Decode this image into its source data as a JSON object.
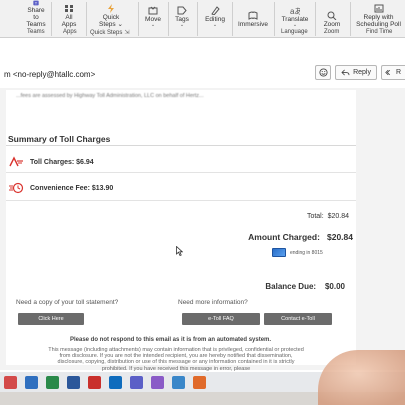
{
  "ribbon": {
    "buttons": [
      {
        "label_line1": "Share to",
        "label_line2": "Teams",
        "icon": "teams-icon"
      },
      {
        "label_line1": "All",
        "label_line2": "Apps",
        "icon": "apps-icon"
      },
      {
        "label_line1": "Quick",
        "label_line2": "Steps",
        "icon": "quick-steps-icon"
      },
      {
        "label_line1": "Move",
        "label_line2": "",
        "icon": "move-icon"
      },
      {
        "label_line1": "Tags",
        "label_line2": "",
        "icon": "tags-icon"
      },
      {
        "label_line1": "Editing",
        "label_line2": "",
        "icon": "editing-icon"
      },
      {
        "label_line1": "Immersive",
        "label_line2": "",
        "icon": "immersive-reader-icon"
      },
      {
        "label_line1": "Translate",
        "label_line2": "",
        "icon": "translate-icon"
      },
      {
        "label_line1": "Zoom",
        "label_line2": "",
        "icon": "zoom-icon"
      },
      {
        "label_line1": "Reply with",
        "label_line2": "Scheduling Poll",
        "icon": "scheduling-poll-icon"
      }
    ],
    "groups": {
      "teams": "Teams",
      "apps": "Apps",
      "quick_steps": "Quick Steps",
      "language": "Language",
      "zoom": "Zoom",
      "find_time": "Find Time"
    }
  },
  "message": {
    "sender": "m <no-reply@htallc.com>",
    "reply_label": "Reply",
    "forward_label": "R",
    "top_legal_text": "...fees are assessed by Highway Toll Administration, LLC on behalf of Hertz..."
  },
  "summary": {
    "title": "Summary of Toll Charges",
    "toll_label": "Toll Charges: $6.94",
    "fee_label": "Convenience Fee: $13.90",
    "total_label": "Total:",
    "total_value": "$20.84",
    "amount_label": "Amount Charged:",
    "amount_value": "$20.84",
    "card_text": "ending in 8015",
    "balance_label": "Balance Due:",
    "balance_value": "$0.00"
  },
  "footer": {
    "copy_question": "Need a copy of your toll statement?",
    "info_question": "Need more information?",
    "click_here": "Click Here",
    "faq": "e-Toll FAQ",
    "contact": "Contact e-Toll",
    "noreply_notice": "Please do not respond to this email as it is from an automated system.",
    "disclaimer": "This message (including attachments) may contain information that is privileged, confidential or protected from disclosure. If you are not the intended recipient, you are hereby notified that dissemination, disclosure, copying, distribution or use of this message or any information contained in it is strictly prohibited. If you have received this message in error, please"
  },
  "colors": {
    "ribbon_bg": "#f1f1f1",
    "teams_purple": "#5b5fc7",
    "toll_red": "#d9332e",
    "card_blue": "#2a6fc9",
    "button_gray": "#6b6b6b"
  }
}
